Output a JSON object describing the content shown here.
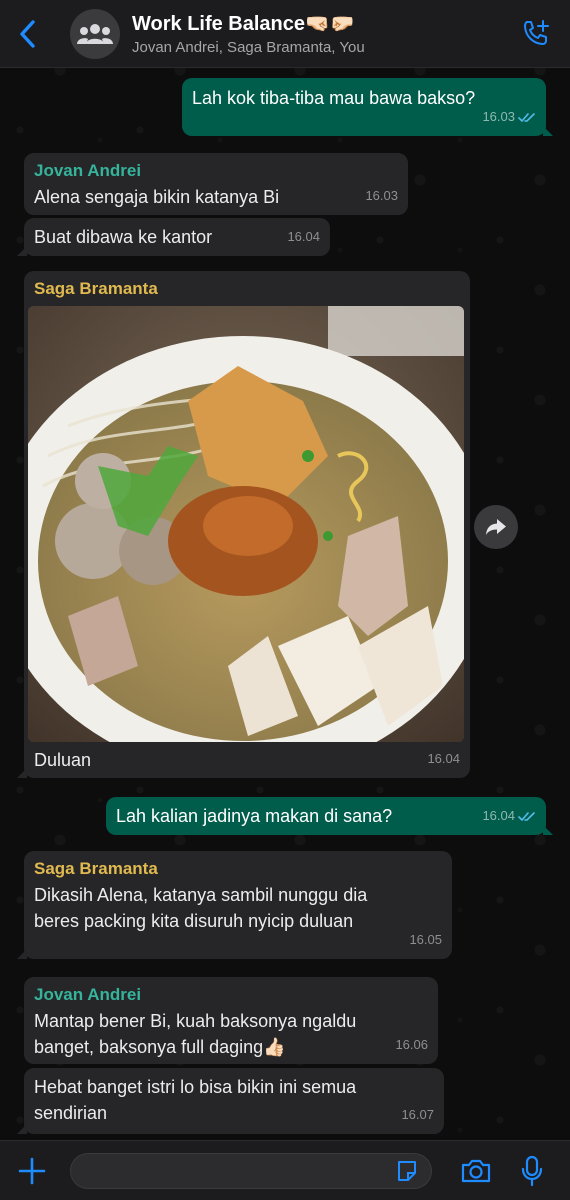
{
  "header": {
    "title": "Work Life Balance🤜🏻🤛🏻",
    "subtitle": "Jovan Andrei, Saga Bramanta, You",
    "back_icon": "chevron-left-icon",
    "avatar_icon": "group-icon",
    "call_icon": "phone-add-icon"
  },
  "colors": {
    "accent": "#1e8bff",
    "outgoing_bubble": "#005c4b",
    "incoming_bubble": "#262628",
    "jovan_name": "#35b39b",
    "saga_name": "#e0b94f",
    "read_tick": "#53bdeb"
  },
  "messages": [
    {
      "id": "m1",
      "direction": "out",
      "text": "Lah kok tiba-tiba mau bawa bakso?",
      "time": "16.03",
      "read": true
    },
    {
      "id": "m2",
      "direction": "in",
      "sender": "Jovan Andrei",
      "text": "Alena sengaja bikin katanya Bi",
      "time": "16.03"
    },
    {
      "id": "m3",
      "direction": "in",
      "text": "Buat dibawa ke kantor",
      "time": "16.04"
    },
    {
      "id": "m4",
      "direction": "in",
      "sender": "Saga Bramanta",
      "image": "bakso-photo",
      "caption": "Duluan",
      "time": "16.04"
    },
    {
      "id": "m5",
      "direction": "out",
      "text": "Lah kalian jadinya makan di sana?",
      "time": "16.04",
      "read": true
    },
    {
      "id": "m6",
      "direction": "in",
      "sender": "Saga Bramanta",
      "line1": "Dikasih Alena, katanya sambil nunggu dia",
      "line2": "beres packing kita disuruh nyicip duluan",
      "time": "16.05"
    },
    {
      "id": "m7",
      "direction": "in",
      "sender": "Jovan Andrei",
      "line1": "Mantap bener Bi, kuah baksonya ngaldu",
      "line2": "banget, baksonya full daging👍🏻",
      "time": "16.06"
    },
    {
      "id": "m8",
      "direction": "in",
      "line1": "Hebat banget istri lo bisa bikin ini semua",
      "line2": "sendirian",
      "time": "16.07"
    }
  ],
  "composer": {
    "input_value": "",
    "plus_icon": "plus-icon",
    "sticker_icon": "sticker-icon",
    "camera_icon": "camera-icon",
    "mic_icon": "microphone-icon"
  }
}
